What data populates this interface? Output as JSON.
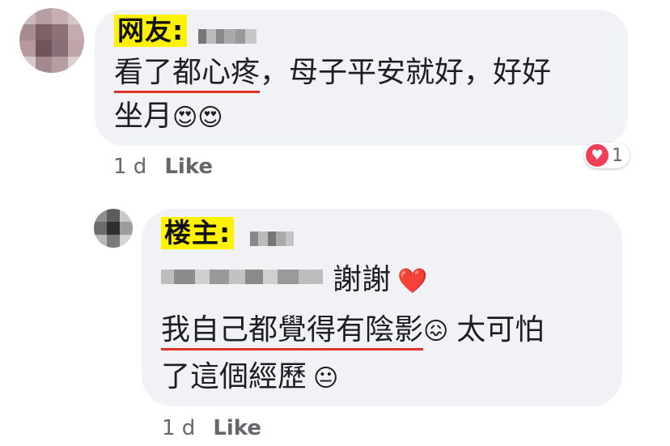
{
  "comment1": {
    "tag": "网友:",
    "line1": "看了都心疼，母子平安就好，好好",
    "line1_underlined": "看了都心疼",
    "line1_rest": "，母子平安就好，好好",
    "line2_text": "坐月",
    "line2_emoji": "😍😍",
    "meta_time": "1 d",
    "meta_like": "Like",
    "reaction_count": "1",
    "reaction_icon": "heart-icon",
    "colors": {
      "tag_bg": "#fff200",
      "underline": "#e0302a",
      "heart": "#f33e58",
      "bubble": "#f0f2f5"
    }
  },
  "comment2": {
    "tag": "楼主:",
    "line1_suffix": "謝謝",
    "line1_emoji": "❤️",
    "line2_underlined": "我自己都覺得有陰影",
    "line2_emoji": "😖",
    "line2_rest": "太可怕",
    "line3_text": "了這個經歷",
    "line3_emoji": "😐",
    "meta_time": "1 d",
    "meta_like": "Like"
  }
}
